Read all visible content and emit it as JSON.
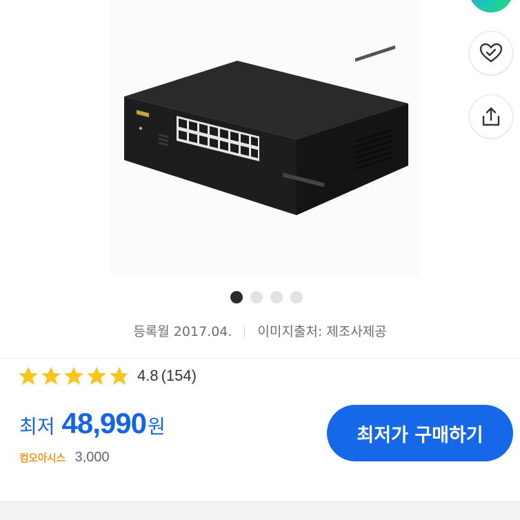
{
  "product": {
    "image_alt": "16-port network switch"
  },
  "carousel": {
    "dots": [
      {
        "active": true
      },
      {
        "active": false
      },
      {
        "active": false
      },
      {
        "active": false
      }
    ]
  },
  "actions": {
    "top_icon": "app-logo-icon",
    "like_icon": "heart-check-icon",
    "share_icon": "share-icon"
  },
  "meta": {
    "registered": "등록월 2017.04.",
    "image_source": "이미지출처: 제조사제공"
  },
  "rating": {
    "stars": 4.8,
    "score": "4.8",
    "count": "(154)",
    "star_color": "#f7c51e"
  },
  "price": {
    "prefix": "최저",
    "value": "48,990",
    "unit": "원",
    "color": "#1565e0"
  },
  "seller": {
    "name": "컴오아시스",
    "shipping": "3,000"
  },
  "buy_button": {
    "label": "최저가 구매하기",
    "color": "#1668e8"
  }
}
